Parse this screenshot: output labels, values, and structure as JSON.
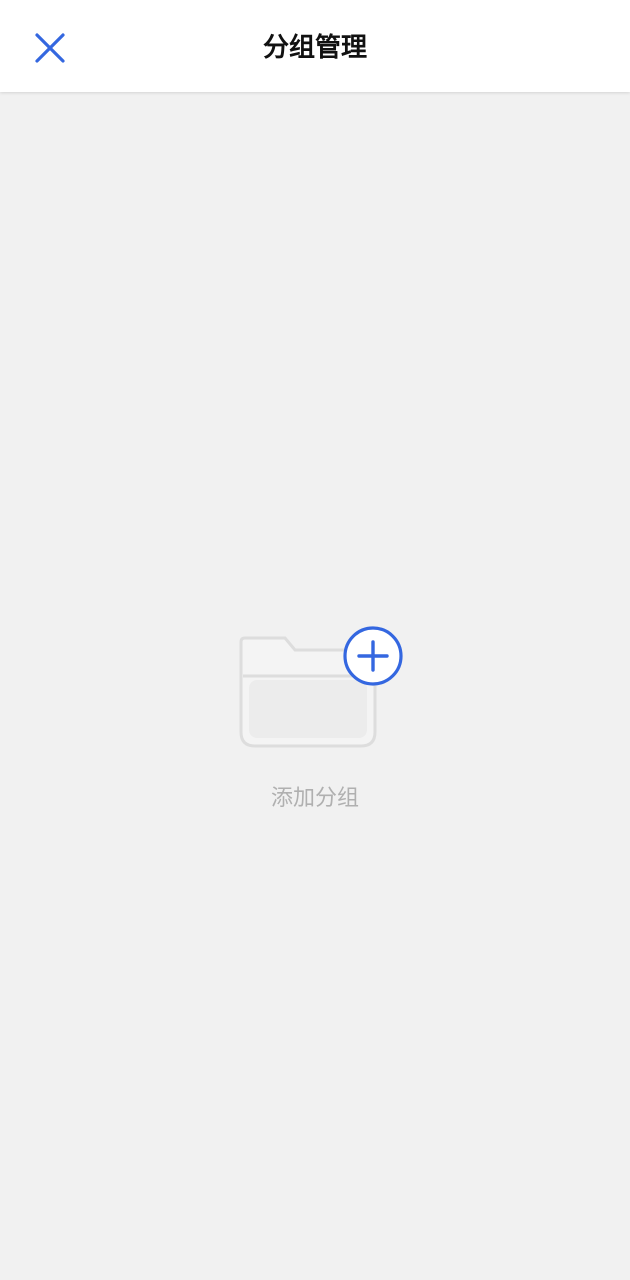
{
  "header": {
    "title": "分组管理",
    "close_icon": "close-icon"
  },
  "empty_state": {
    "illustration_icon": "folder-add-icon",
    "label": "添加分组"
  },
  "colors": {
    "accent": "#3467e0",
    "background": "#f1f1f1",
    "header_bg": "#ffffff",
    "muted_text": "#b0b0b0",
    "folder_stroke": "#dcdcdc"
  }
}
